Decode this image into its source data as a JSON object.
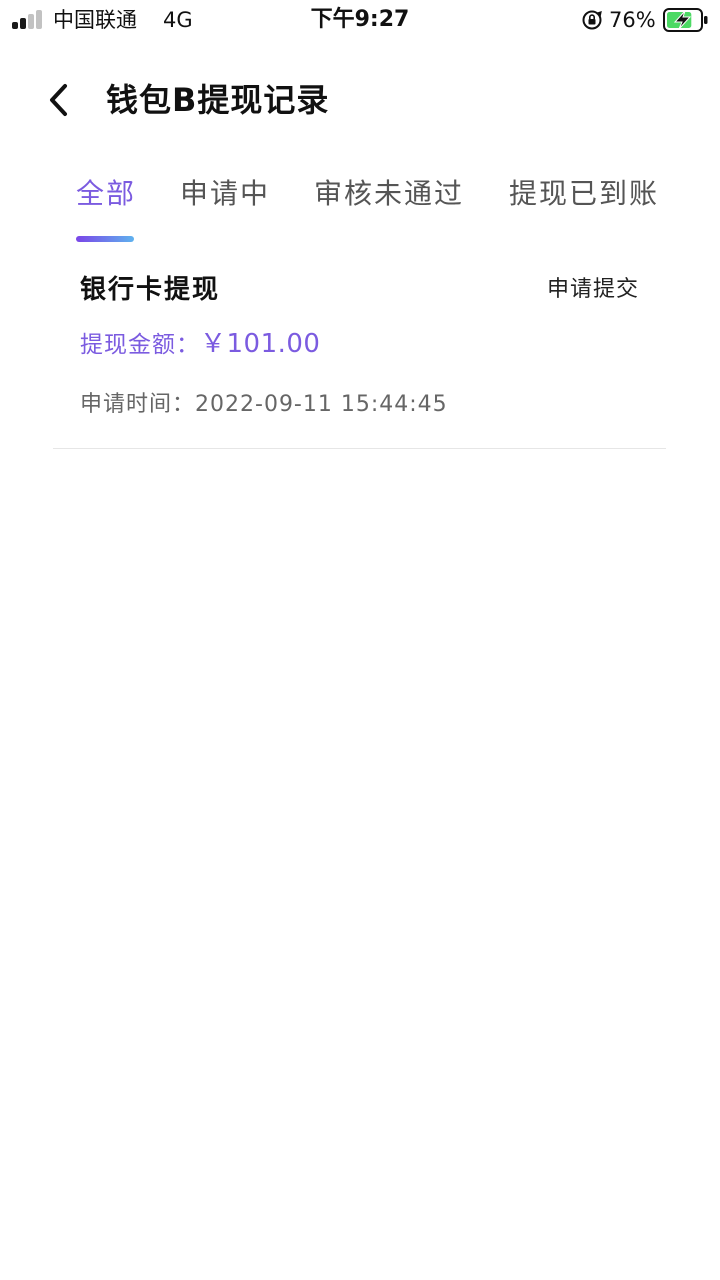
{
  "status_bar": {
    "carrier": "中国联通",
    "network": "4G",
    "time": "下午9:27",
    "battery_percent": "76%",
    "battery_level": 0.76,
    "icons": [
      "signal-icon",
      "orientation-lock-icon",
      "battery-charging-icon"
    ]
  },
  "header": {
    "back_icon": "chevron-left-icon",
    "title": "钱包B提现记录"
  },
  "tabs": [
    {
      "label": "全部",
      "active": true
    },
    {
      "label": "申请中",
      "active": false
    },
    {
      "label": "审核未通过",
      "active": false
    },
    {
      "label": "提现已到账",
      "active": false
    }
  ],
  "records": [
    {
      "type": "银行卡提现",
      "status": "申请提交",
      "amount_label": "提现金额：",
      "amount_value": "￥101.00",
      "time_label": "申请时间：",
      "time_value": "2022-09-11 15:44:45"
    }
  ],
  "colors": {
    "accent": "#7b5be0",
    "underline_start": "#7a45e8",
    "underline_end": "#5fb2ee",
    "battery_fill": "#4cd964"
  }
}
